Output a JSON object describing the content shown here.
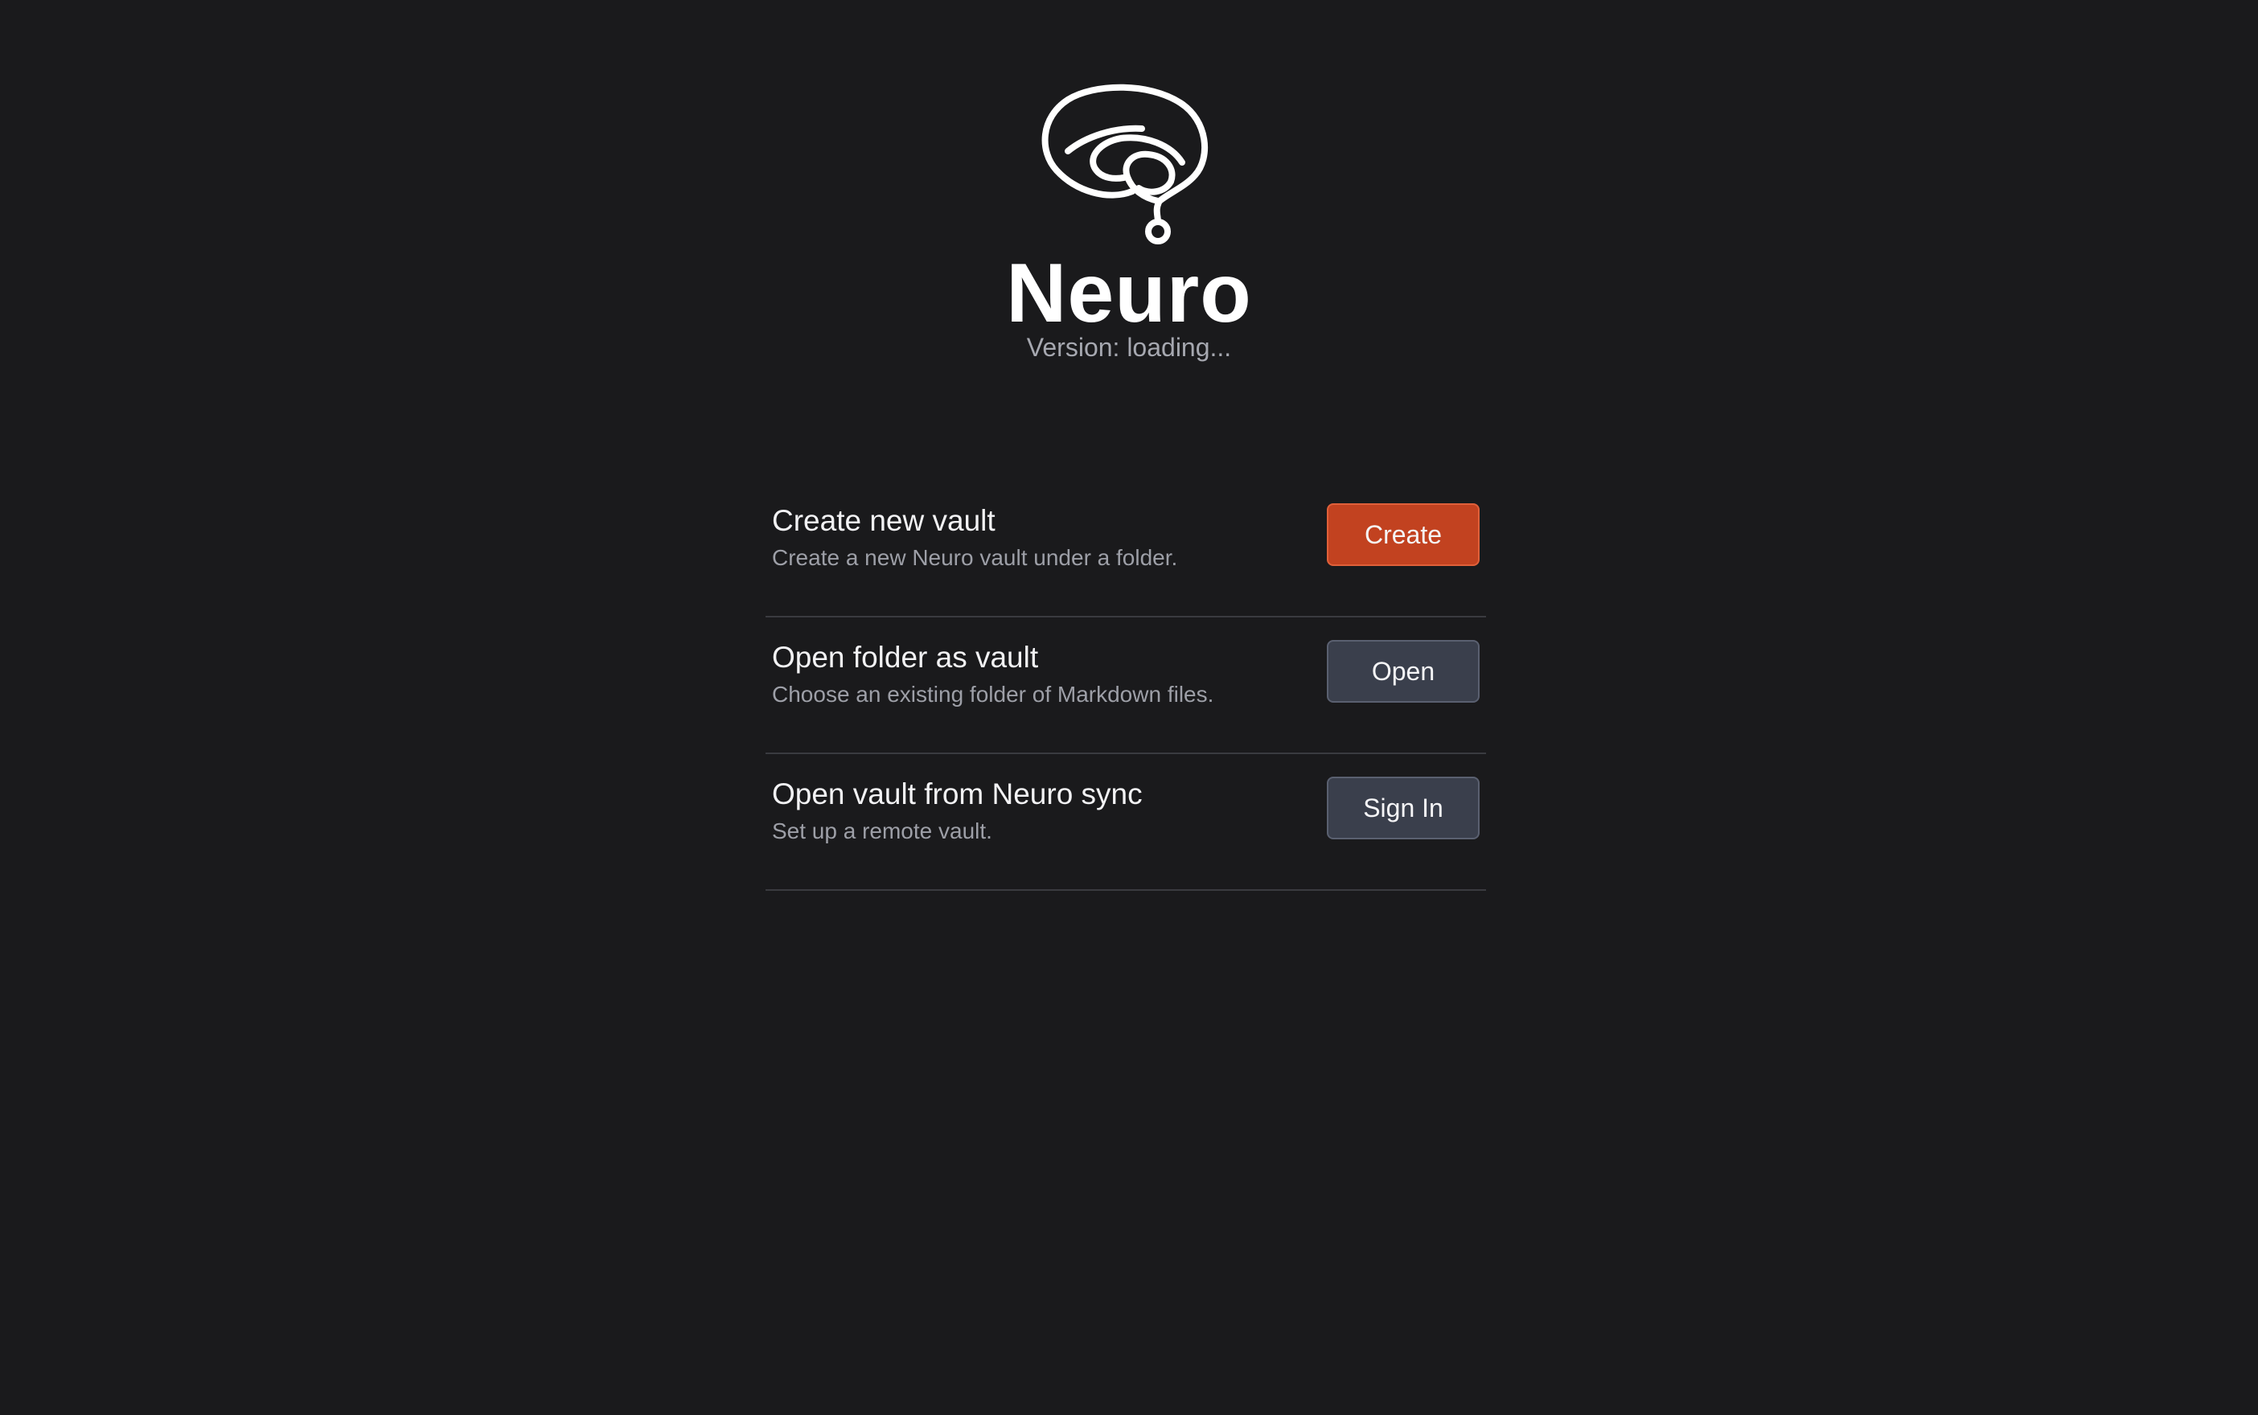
{
  "app": {
    "name": "Neuro",
    "version_text": "Version: loading...",
    "logo_icon": "brain-icon"
  },
  "options": [
    {
      "title": "Create new vault",
      "description": "Create a new Neuro vault under a folder.",
      "button_label": "Create",
      "button_style": "primary"
    },
    {
      "title": "Open folder as vault",
      "description": "Choose an existing folder of Markdown files.",
      "button_label": "Open",
      "button_style": "secondary"
    },
    {
      "title": "Open vault from Neuro sync",
      "description": "Set up a remote vault.",
      "button_label": "Sign In",
      "button_style": "secondary"
    }
  ],
  "colors": {
    "background": "#1a1a1c",
    "accent": "#c24220",
    "secondary_button": "#3a3f4c",
    "muted_text": "#9d9fa7",
    "divider": "#3a3b40"
  }
}
